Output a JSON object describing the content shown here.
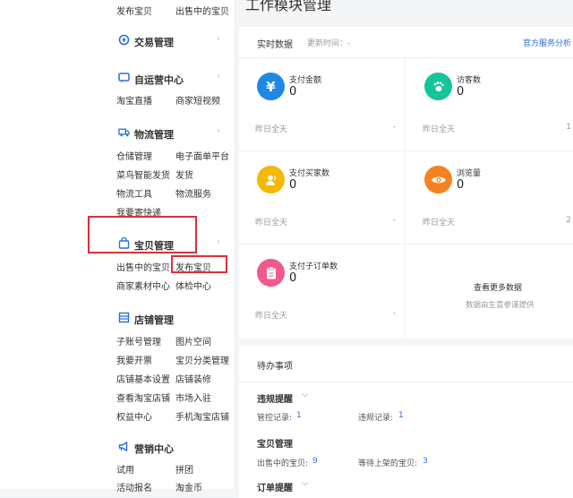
{
  "sidebar": {
    "top_links": [
      "发布宝贝",
      "出售中的宝贝"
    ],
    "sections": [
      {
        "title": "交易管理",
        "icon": "trade-icon",
        "links": []
      },
      {
        "title": "自运营中心",
        "icon": "chat-icon",
        "links": [
          "淘宝直播",
          "商家短视频"
        ]
      },
      {
        "title": "物流管理",
        "icon": "truck-icon",
        "links": [
          "仓储管理",
          "电子面单平台",
          "菜鸟智能发货",
          "发货",
          "物流工具",
          "物流服务",
          "我要寄快递"
        ]
      },
      {
        "title": "宝贝管理",
        "icon": "bag-icon",
        "links": [
          "出售中的宝贝",
          "发布宝贝",
          "商家素材中心",
          "体检中心"
        ]
      },
      {
        "title": "店铺管理",
        "icon": "store-icon",
        "links": [
          "子账号管理",
          "图片空间",
          "我要开票",
          "宝贝分类管理",
          "店铺基本设置",
          "店铺装修",
          "查看淘宝店铺",
          "市场入驻",
          "权益中心",
          "手机淘宝店铺"
        ]
      },
      {
        "title": "营销中心",
        "icon": "megaphone-icon",
        "links": [
          "试用",
          "拼团",
          "活动报名",
          "淘金币"
        ]
      }
    ]
  },
  "main": {
    "page_title": "工作模块管理",
    "realtime": {
      "title": "实时数据",
      "update_label": "更新时间：-",
      "official_link": "官方服务分析",
      "metrics": [
        {
          "label": "支付金额",
          "value": "0",
          "footer": "昨日全天",
          "footer_value": "-",
          "icon": "yuan-icon",
          "color": "#1e88e5"
        },
        {
          "label": "访客数",
          "value": "0",
          "footer": "昨日全天",
          "footer_value": "1",
          "icon": "footprint-icon",
          "color": "#14c59a"
        },
        {
          "label": "支付买家数",
          "value": "0",
          "footer": "昨日全天",
          "footer_value": "-",
          "icon": "user-icon",
          "color": "#f5b800"
        },
        {
          "label": "浏览量",
          "value": "0",
          "footer": "昨日全天",
          "footer_value": "2",
          "icon": "eye-icon",
          "color": "#f58220"
        },
        {
          "label": "支付子订单数",
          "value": "0",
          "footer": "昨日全天",
          "footer_value": "-",
          "icon": "clipboard-icon",
          "color": "#ef5a8a"
        }
      ],
      "more": {
        "title": "查看更多数据",
        "sub": "数据由生意参谋提供"
      }
    },
    "todo": {
      "title": "待办事项",
      "violation": {
        "title": "违规提醒",
        "items": [
          {
            "label": "管控记录:",
            "value": "1"
          },
          {
            "label": "违规记录:",
            "value": "1"
          }
        ]
      },
      "goods": {
        "title": "宝贝管理",
        "items": [
          {
            "label": "出售中的宝贝:",
            "value": "9"
          },
          {
            "label": "等待上架的宝贝:",
            "value": "3"
          }
        ]
      },
      "orders": {
        "title": "订单提醒"
      }
    }
  }
}
